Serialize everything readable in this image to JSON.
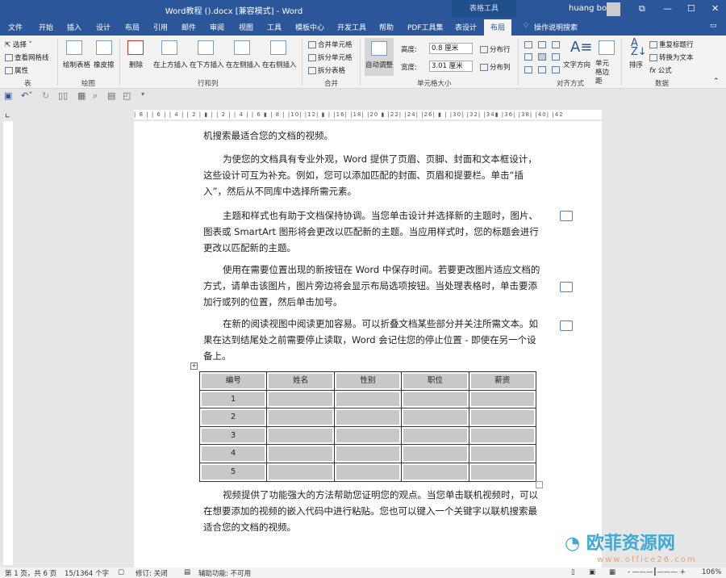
{
  "window": {
    "title": "Word教程 ().docx [兼容模式]  -  Word",
    "context_tab": "表格工具",
    "user": "huang bo",
    "controls": [
      "⧉",
      "—",
      "☐",
      "✕"
    ]
  },
  "tabs": [
    "文件",
    "开始",
    "插入",
    "设计",
    "布局",
    "引用",
    "邮件",
    "审阅",
    "视图",
    "工具",
    "模板中心",
    "开发工具",
    "帮助",
    "PDF工具集",
    "表设计",
    "布局",
    "操作说明搜索"
  ],
  "ribbon": {
    "table": {
      "select": "选择",
      "gridlines": "查看网格线",
      "properties": "属性",
      "label": "表"
    },
    "draw": {
      "draw_table": "绘制表格",
      "eraser": "橡皮擦",
      "label": "绘图"
    },
    "rows_cols": {
      "delete": "删除",
      "above": "在上方插入",
      "below": "在下方插入",
      "left": "在左侧插入",
      "right": "在右侧插入",
      "label": "行和列"
    },
    "merge": {
      "merge_cells": "合并单元格",
      "split_cells": "拆分单元格",
      "split_table": "拆分表格",
      "label": "合并"
    },
    "cell_size": {
      "autofit": "自动调整",
      "height_label": "高度:",
      "height": "0.8 厘米",
      "width_label": "宽度:",
      "width": "3.01 厘米",
      "dist_rows": "分布行",
      "dist_cols": "分布列",
      "label": "单元格大小"
    },
    "alignment": {
      "text_direction": "文字方向",
      "margins": "单元格边距",
      "label": "对齐方式"
    },
    "data": {
      "sort": "排序",
      "repeat_header": "重复标题行",
      "to_text": "转换为文本",
      "formula": "公式",
      "label": "数据"
    }
  },
  "ruler": "| 8 |  | 6 |  | 4 |  | 2 |  ▮  |  | 2 |  | 4 |  | 6 ▮ | 8 |  |10|  |12|  ▮ |  |16|  |18|  |20 ▮ |22|  |24|  |26|   ▮ |  |30|  |32|  |34▮ |36|  |38|  |40|  |42",
  "document": {
    "paragraphs": [
      "机搜索最适合您的文档的视频。",
      "为使您的文档具有专业外观，Word 提供了页眉、页脚、封面和文本框设计，这些设计可互为补充。例如，您可以添加匹配的封面、页眉和提要栏。单击“插入”，然后从不同库中选择所需元素。",
      "主题和样式也有助于文档保持协调。当您单击设计并选择新的主题时，图片、图表或 SmartArt 图形将会更改以匹配新的主题。当应用样式时，您的标题会进行更改以匹配新的主题。",
      "使用在需要位置出现的新按钮在 Word 中保存时间。若要更改图片适应文档的方式，请单击该图片，图片旁边将会显示布局选项按钮。当处理表格时，单击要添加行或列的位置，然后单击加号。",
      "在新的阅读视图中阅读更加容易。可以折叠文档某些部分并关注所需文本。如果在达到结尾处之前需要停止读取，Word 会记住您的停止位置 - 即使在另一个设备上。",
      "视频提供了功能强大的方法帮助您证明您的观点。当您单击联机视频时，可以在想要添加的视频的嵌入代码中进行粘贴。您也可以键入一个关键字以联机搜索最适合您的文档的视频。"
    ],
    "table": {
      "headers": [
        "编号",
        "姓名",
        "性别",
        "职位",
        "薪资"
      ],
      "rows": [
        [
          "1",
          "",
          "",
          "",
          ""
        ],
        [
          "2",
          "",
          "",
          "",
          ""
        ],
        [
          "3",
          "",
          "",
          "",
          ""
        ],
        [
          "4",
          "",
          "",
          "",
          ""
        ],
        [
          "5",
          "",
          "",
          "",
          ""
        ]
      ]
    }
  },
  "status": {
    "page": "第 1 页，共 6 页",
    "words": "15/1364 个字",
    "track": "修订: 关闭",
    "accessibility": "辅助功能: 不可用",
    "zoom": "106%"
  },
  "watermark": {
    "name": "欧菲资源网",
    "url": "www.office26.com"
  }
}
